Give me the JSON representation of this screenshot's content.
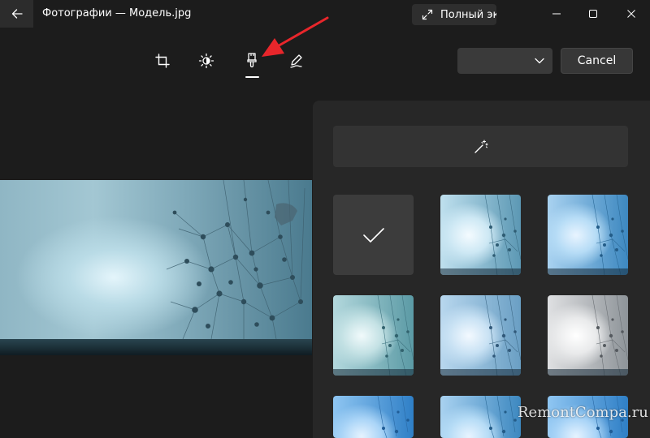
{
  "window": {
    "title": "Фотографии — Модель.jpg"
  },
  "titlebar": {
    "fullscreen_label": "Полный экран",
    "back_icon": "arrow-left-icon",
    "fullscreen_icon": "expand-diagonal-icon",
    "window_controls": [
      "minimize-icon",
      "maximize-icon",
      "close-icon"
    ]
  },
  "toolbar": {
    "tools": [
      {
        "icon": "crop-icon",
        "active": false
      },
      {
        "icon": "brightness-icon",
        "active": false
      },
      {
        "icon": "filter-brush-icon",
        "active": true
      },
      {
        "icon": "markup-pen-icon",
        "active": false
      }
    ],
    "save_dropdown_value": "",
    "cancel_label": "Cancel"
  },
  "filters_panel": {
    "auto_enhance_icon": "magic-wand-icon",
    "selected_icon": "checkmark-icon",
    "selected_filter_index": 0
  },
  "annotation": {
    "color": "#e8262b"
  },
  "watermark": {
    "text": "RemontCompa.ru"
  },
  "colors": {
    "background": "#1c1c1c",
    "panel": "#272727",
    "button": "#373737",
    "accent_text": "#ffffff"
  }
}
